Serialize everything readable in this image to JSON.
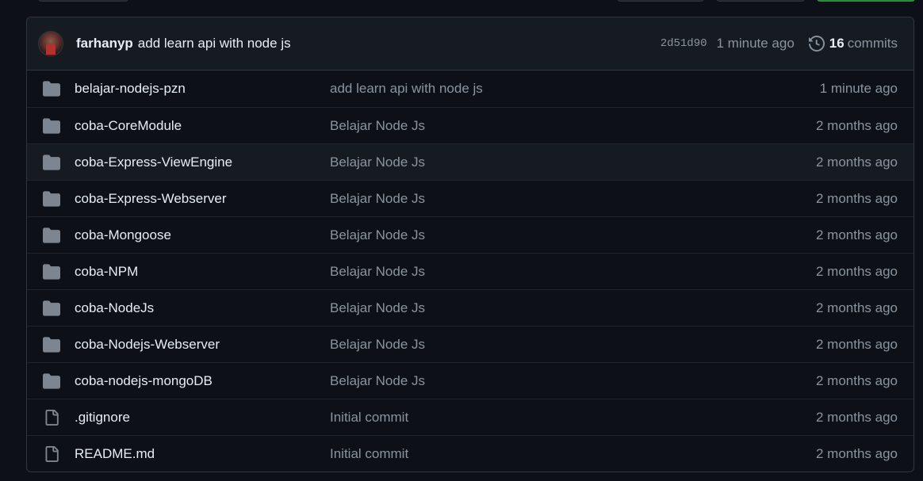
{
  "latest_commit": {
    "author": "farhanyp",
    "message": "add learn api with node js",
    "sha": "2d51d90",
    "time": "1 minute ago",
    "commit_count": "16",
    "commits_label": "commits"
  },
  "files": [
    {
      "type": "folder",
      "name": "belajar-nodejs-pzn",
      "message": "add learn api with node js",
      "age": "1 minute ago"
    },
    {
      "type": "folder",
      "name": "coba-CoreModule",
      "message": "Belajar Node Js",
      "age": "2 months ago"
    },
    {
      "type": "folder",
      "name": "coba-Express-ViewEngine",
      "message": "Belajar Node Js",
      "age": "2 months ago"
    },
    {
      "type": "folder",
      "name": "coba-Express-Webserver",
      "message": "Belajar Node Js",
      "age": "2 months ago"
    },
    {
      "type": "folder",
      "name": "coba-Mongoose",
      "message": "Belajar Node Js",
      "age": "2 months ago"
    },
    {
      "type": "folder",
      "name": "coba-NPM",
      "message": "Belajar Node Js",
      "age": "2 months ago"
    },
    {
      "type": "folder",
      "name": "coba-NodeJs",
      "message": "Belajar Node Js",
      "age": "2 months ago"
    },
    {
      "type": "folder",
      "name": "coba-Nodejs-Webserver",
      "message": "Belajar Node Js",
      "age": "2 months ago"
    },
    {
      "type": "folder",
      "name": "coba-nodejs-mongoDB",
      "message": "Belajar Node Js",
      "age": "2 months ago"
    },
    {
      "type": "file",
      "name": ".gitignore",
      "message": "Initial commit",
      "age": "2 months ago"
    },
    {
      "type": "file",
      "name": "README.md",
      "message": "Initial commit",
      "age": "2 months ago"
    }
  ],
  "icons": {
    "folder": "folder-icon",
    "file": "file-icon",
    "history": "history-icon"
  },
  "colors": {
    "background": "#0d1117",
    "header_bg": "#161b22",
    "border": "#30363d",
    "text": "#e6edf3",
    "muted": "#8b949e",
    "folder_icon": "#7d8590"
  }
}
